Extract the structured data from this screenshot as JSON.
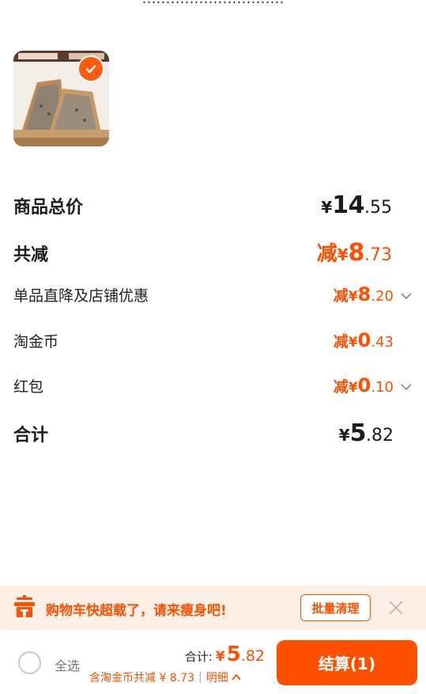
{
  "header": {
    "partial_text": "…………………………"
  },
  "product": {
    "image_caption": "全麦吐司",
    "selected": true
  },
  "summary": {
    "total_price": {
      "label": "商品总价",
      "currency": "¥",
      "int": "14",
      "dec": ".55"
    },
    "total_discount": {
      "label": "共减",
      "prefix": "减",
      "currency": "¥",
      "int": "8",
      "dec": ".73"
    },
    "store_discount": {
      "label": "单品直降及店铺优惠",
      "prefix": "减",
      "currency": "¥",
      "int": "8",
      "dec": ".20"
    },
    "taojinbi": {
      "label": "淘金币",
      "prefix": "减",
      "currency": "¥",
      "int": "0",
      "dec": ".43"
    },
    "red_packet": {
      "label": "红包",
      "prefix": "减",
      "currency": "¥",
      "int": "0",
      "dec": ".10"
    },
    "grand_total": {
      "label": "合计",
      "currency": "¥",
      "int": "5",
      "dec": ".82"
    }
  },
  "banner": {
    "text": "购物车快超载了，请来瘦身吧!",
    "button": "批量清理"
  },
  "bottom": {
    "select_all": "全选",
    "total_label": "合计:",
    "currency": "¥",
    "total_int": "5",
    "total_dec": ".82",
    "saving_text": "含淘金币共减 ¥ 8.73",
    "detail_label": "明细",
    "checkout_label": "结算(1)"
  },
  "colors": {
    "accent": "#ff5000",
    "banner_bg": "#fff0e6"
  }
}
